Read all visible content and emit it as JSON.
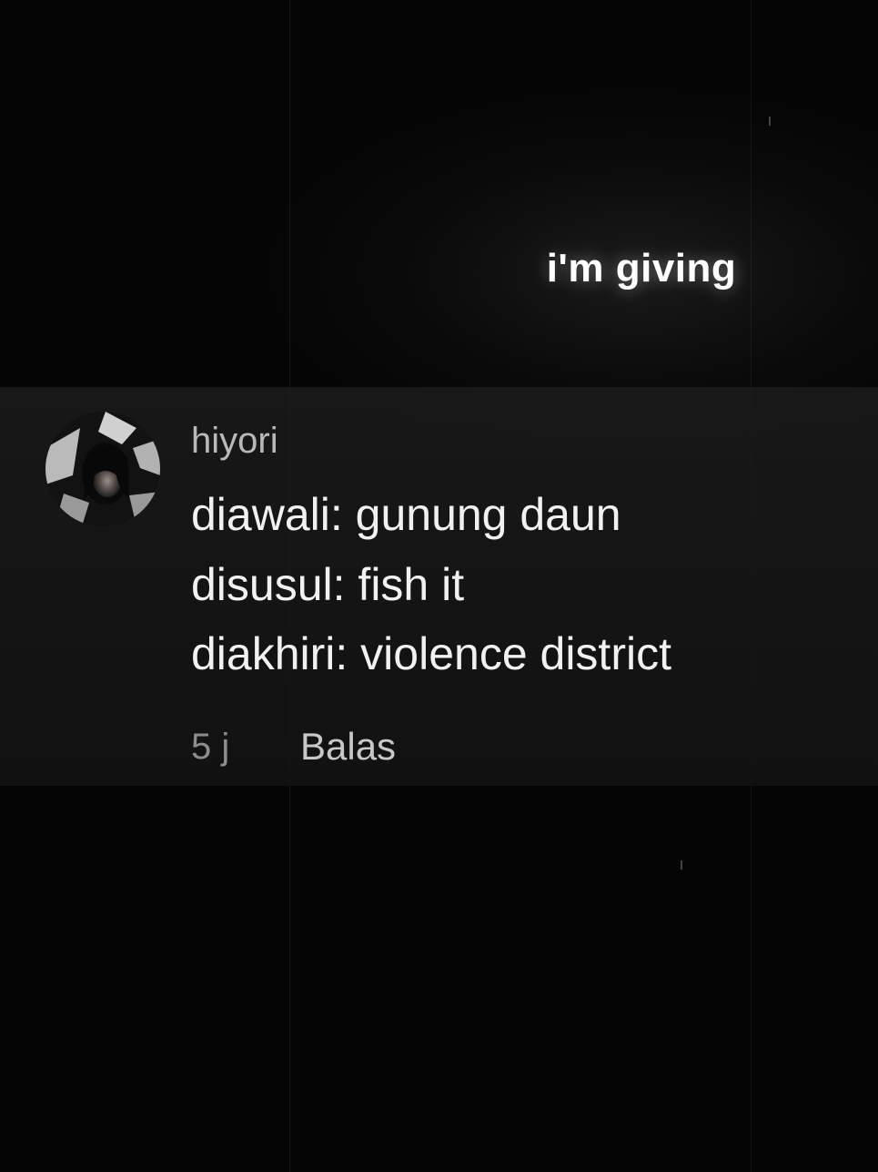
{
  "caption": "i'm giving",
  "comment": {
    "username": "hiyori",
    "lines": [
      "diawali: gunung daun",
      "disusul: fish it",
      "diakhiri: violence district"
    ],
    "time": "5 j",
    "reply_label": "Balas"
  },
  "colors": {
    "background": "#000000",
    "text_primary": "#f1f1f1",
    "text_secondary": "#b9b9b9",
    "text_muted": "#8d8d8d"
  }
}
